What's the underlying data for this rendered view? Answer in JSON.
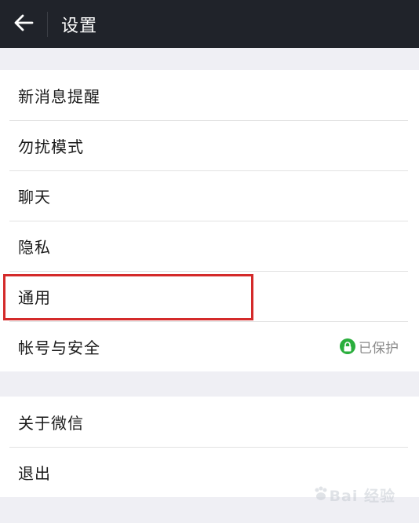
{
  "header": {
    "title": "设置",
    "back_icon": "arrow-left-icon"
  },
  "colors": {
    "topbar": "#20232a",
    "background": "#efeff4",
    "accent_green": "#2aae3c",
    "highlight_red": "#d42a2a"
  },
  "settings": {
    "group1": [
      {
        "label": "新消息提醒"
      },
      {
        "label": "勿扰模式"
      },
      {
        "label": "聊天"
      },
      {
        "label": "隐私"
      },
      {
        "label": "通用"
      },
      {
        "label": "帐号与安全",
        "status": "已保护",
        "status_icon": "lock-icon"
      }
    ],
    "group2": [
      {
        "label": "关于微信"
      },
      {
        "label": "退出"
      }
    ]
  },
  "annotation": {
    "highlighted_item": "通用"
  },
  "watermark": {
    "text": "Bai 经验"
  }
}
